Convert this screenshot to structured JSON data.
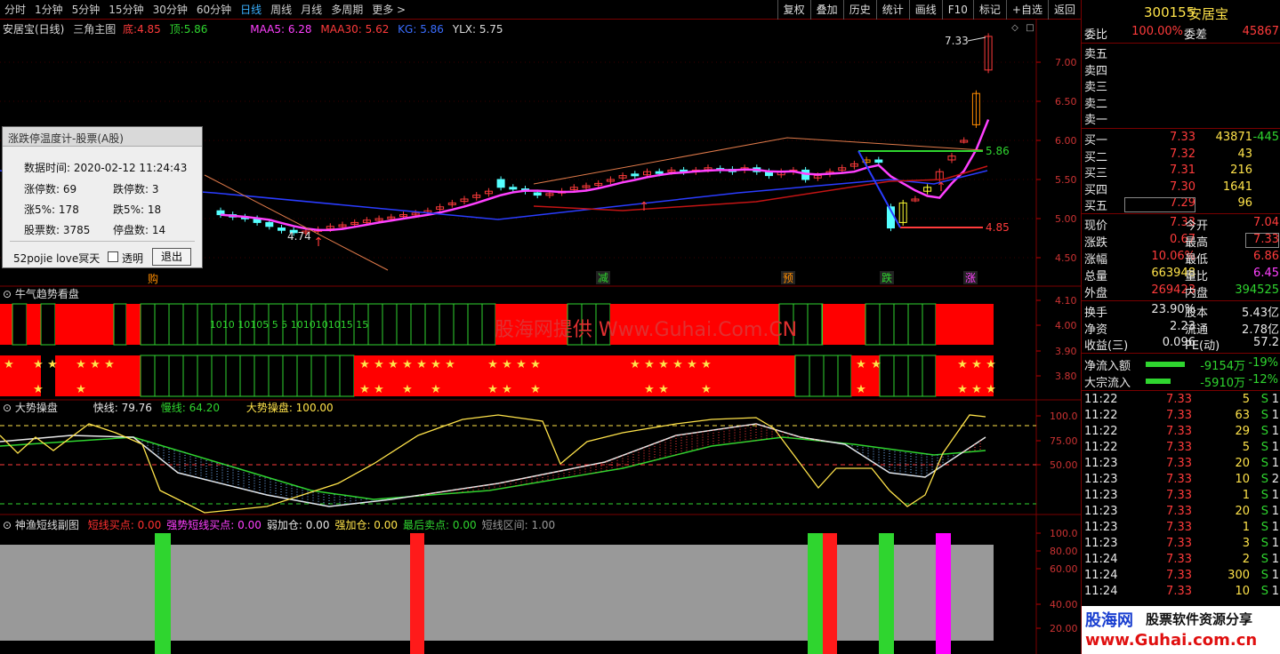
{
  "toolbar": {
    "periods": [
      "分时",
      "1分钟",
      "5分钟",
      "15分钟",
      "30分钟",
      "60分钟",
      "日线",
      "周线",
      "月线",
      "多周期",
      "更多 >"
    ],
    "active_index": 6,
    "buttons": [
      "复权",
      "叠加",
      "历史",
      "统计",
      "画线",
      "F10",
      "标记",
      "+自选",
      "返回"
    ]
  },
  "main_chart": {
    "title": "安居宝(日线)",
    "indicator": "三角主图",
    "low_label": "底:",
    "low_value": "4.85",
    "top_label": "顶:",
    "top_value": "5.86",
    "ma5": "MAA5: 6.28",
    "ma30": "MAA30: 5.62",
    "kg": "KG: 5.86",
    "ylx": "YLX: 5.75",
    "y_ticks": [
      "7.00",
      "6.50",
      "6.00",
      "5.50",
      "5.00",
      "4.50"
    ],
    "high_mark": "7.33",
    "low_mark": "4.74",
    "line_label_top": "5.86",
    "line_label_bot": "4.85",
    "signals": [
      "减",
      "预",
      "跌",
      "涨"
    ],
    "bottom_left": "购"
  },
  "trend_panel": {
    "title": "牛气趋势看盘",
    "y_ticks": [
      "4.10",
      "4.00",
      "3.90",
      "3.80"
    ],
    "row_text": "1010  10105 5 5 1010101015 15",
    "watermark": "股海网提供 Www.Guhai.Com.CN"
  },
  "dashi_panel": {
    "title": "大势操盘",
    "fast": "快线: 79.76",
    "slow": "慢线: 64.20",
    "ops": "大势操盘: 100.00",
    "y_ticks": [
      "100.0",
      "75.00",
      "50.00"
    ]
  },
  "shenyu_panel": {
    "title": "神渔短线副图",
    "items": [
      {
        "t": "短线买点: 0.00",
        "c": "#ff3030"
      },
      {
        "t": "强势短线买点: 0.00",
        "c": "#ff40ff"
      },
      {
        "t": "弱加仓: 0.00",
        "c": "#e8e8e8"
      },
      {
        "t": "强加仓: 0.00",
        "c": "#ffe34a"
      },
      {
        "t": "最后卖点: 0.00",
        "c": "#2fd52f"
      },
      {
        "t": "短线区间: 1.00",
        "c": "#999999"
      }
    ],
    "y_ticks": [
      "100.0",
      "80.00",
      "60.00",
      "40.00",
      "20.00"
    ]
  },
  "dialog": {
    "title": "涨跌停温度计-股票(A股)",
    "time_label": "数据时间:",
    "time_value": "2020-02-12 11:24:43",
    "zt_label": "涨停数:",
    "zt": "69",
    "dt_label": "跌停数:",
    "dt": "3",
    "z5_label": "涨5%:",
    "z5": "178",
    "d5_label": "跌5%:",
    "d5": "18",
    "total_label": "股票数:",
    "total": "3785",
    "stop_label": "停盘数:",
    "stop": "14",
    "footer": "52pojie love冥天",
    "transparent": "透明",
    "exit": "退出"
  },
  "quote": {
    "code": "300155",
    "name": "安居宝",
    "wb_label": "委比",
    "wb": "100.00%",
    "wc_label": "委差",
    "wc": "45867",
    "sells": [
      "卖五",
      "卖四",
      "卖三",
      "卖二",
      "卖一"
    ],
    "buys": [
      {
        "l": "买一",
        "p": "7.33",
        "v": "43871",
        "d": "-445"
      },
      {
        "l": "买二",
        "p": "7.32",
        "v": "43",
        "d": ""
      },
      {
        "l": "买三",
        "p": "7.31",
        "v": "216",
        "d": ""
      },
      {
        "l": "买四",
        "p": "7.30",
        "v": "1641",
        "d": ""
      },
      {
        "l": "买五",
        "p": "7.29",
        "v": "96",
        "d": ""
      }
    ],
    "stats": [
      {
        "a": "现价",
        "av": "7.33",
        "ac": "red",
        "b": "今开",
        "bv": "7.04",
        "bc": "red"
      },
      {
        "a": "涨跌",
        "av": "0.67",
        "ac": "red",
        "b": "最高",
        "bv": "7.33",
        "bc": "red"
      },
      {
        "a": "涨幅",
        "av": "10.06%",
        "ac": "red",
        "b": "最低",
        "bv": "6.86",
        "bc": "red"
      },
      {
        "a": "总量",
        "av": "663948",
        "ac": "yellow",
        "b": "量比",
        "bv": "6.45",
        "bc": "mag"
      },
      {
        "a": "外盘",
        "av": "269423",
        "ac": "red",
        "b": "内盘",
        "bv": "394525",
        "bc": "green"
      }
    ],
    "stats2": [
      {
        "a": "换手",
        "av": "23.90%",
        "b": "股本",
        "bv": "5.43亿"
      },
      {
        "a": "净资",
        "av": "2.23",
        "b": "流通",
        "bv": "2.78亿"
      },
      {
        "a": "收益(三)",
        "av": "0.096",
        "b": "PE(动)",
        "bv": "57.2"
      }
    ],
    "flows": [
      {
        "l": "净流入额",
        "v": "-9154万",
        "p": "-19%"
      },
      {
        "l": "大宗流入",
        "v": "-5910万",
        "p": "-12%"
      }
    ],
    "ticks": [
      {
        "t": "11:22",
        "p": "7.33",
        "v": "5",
        "s": "S",
        "n": "1"
      },
      {
        "t": "11:22",
        "p": "7.33",
        "v": "63",
        "s": "S",
        "n": "1"
      },
      {
        "t": "11:22",
        "p": "7.33",
        "v": "29",
        "s": "S",
        "n": "1"
      },
      {
        "t": "11:22",
        "p": "7.33",
        "v": "5",
        "s": "S",
        "n": "1"
      },
      {
        "t": "11:23",
        "p": "7.33",
        "v": "20",
        "s": "S",
        "n": "1"
      },
      {
        "t": "11:23",
        "p": "7.33",
        "v": "10",
        "s": "S",
        "n": "2"
      },
      {
        "t": "11:23",
        "p": "7.33",
        "v": "1",
        "s": "S",
        "n": "1"
      },
      {
        "t": "11:23",
        "p": "7.33",
        "v": "20",
        "s": "S",
        "n": "1"
      },
      {
        "t": "11:23",
        "p": "7.33",
        "v": "1",
        "s": "S",
        "n": "1"
      },
      {
        "t": "11:23",
        "p": "7.33",
        "v": "3",
        "s": "S",
        "n": "1"
      },
      {
        "t": "11:24",
        "p": "7.33",
        "v": "2",
        "s": "S",
        "n": "1"
      },
      {
        "t": "11:24",
        "p": "7.33",
        "v": "300",
        "s": "S",
        "n": "1"
      },
      {
        "t": "11:24",
        "p": "7.33",
        "v": "10",
        "s": "S",
        "n": "1"
      }
    ],
    "watermark1": "股海网",
    "watermark2": "股票软件资源分享",
    "watermark3": "www.Guhai.com.cn"
  }
}
